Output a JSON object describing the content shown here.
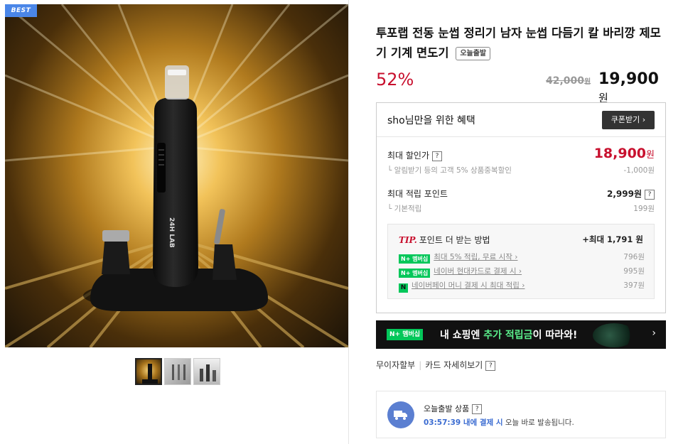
{
  "gallery": {
    "badge": "BEST",
    "product_brand_on_device": "24H LAB",
    "thumbnails": [
      "thumbnail-1",
      "thumbnail-2",
      "thumbnail-3"
    ]
  },
  "product": {
    "title": "투포랩 전동 눈썹 정리기 남자 눈썹 다듬기 칼 바리깡 제모기 기계 면도기",
    "today_tag": "오늘출발",
    "discount": "52%",
    "original_price": "42,000",
    "original_unit": "원",
    "sale_price": "19,900",
    "sale_unit": "원"
  },
  "benefits": {
    "title": "sho님만을 위한 혜택",
    "coupon_button": "쿠폰받기 ›",
    "max_discount_label": "최대 할인가",
    "max_discount_value": "18,900",
    "max_discount_unit": "원",
    "alert_discount_label": "└ 알림받기 등의 고객 5% 상품중복할인",
    "alert_discount_value": "-1,000원",
    "max_points_label": "최대 적립 포인트",
    "max_points_value": "2,999원",
    "base_points_label": "└ 기본적립",
    "base_points_value": "199원",
    "tip": {
      "tip_word": "TIP.",
      "title": "포인트 더 받는 방법",
      "total": "+최대 1,791 원",
      "rows": [
        {
          "badge": "N+ 멤버십",
          "text": "최대 5% 적립, 무료 시작 ›",
          "value": "796원"
        },
        {
          "badge": "N+ 멤버십",
          "text": "네이버 현대카드로 결제 시 ›",
          "value": "995원"
        },
        {
          "badge": "N",
          "text": "네이버페이 머니 결제 시 최대 적립 ›",
          "value": "397원"
        }
      ]
    }
  },
  "banner": {
    "badge": "N+ 멤버십",
    "text_before": "내 쇼핑엔 ",
    "text_highlight": "추가 적립금",
    "text_after": "이 따라와!",
    "arrow": "›"
  },
  "links": {
    "installment": "무이자할부",
    "card_detail": "카드 자세히보기"
  },
  "shipping": {
    "title": "오늘출발 상품",
    "countdown": "03:57:39 내에 결제 시",
    "desc_rest": " 오늘 바로 발송됩니다."
  },
  "colors": {
    "accent_red": "#c8102e",
    "naver_green": "#03c75a",
    "ship_blue": "#5b7fd1"
  }
}
